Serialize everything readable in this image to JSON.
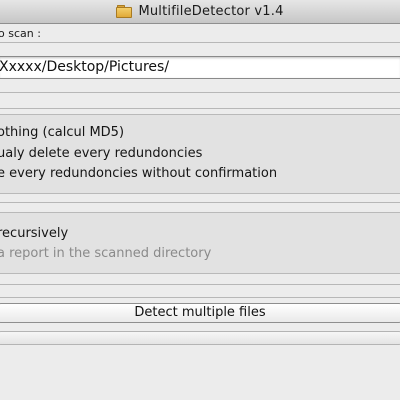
{
  "window": {
    "title": "MultifileDetector v1.4",
    "icon": "folder-icon"
  },
  "scan": {
    "label": "o scan :",
    "path_value": "Xxxxx/Desktop/Pictures/"
  },
  "action_options": {
    "items": [
      {
        "label": "othing (calcul MD5)",
        "enabled": true
      },
      {
        "label": "ualy delete every redundoncies",
        "enabled": true
      },
      {
        "label": "e every redundoncies without confirmation",
        "enabled": true
      }
    ]
  },
  "scan_options": {
    "items": [
      {
        "label": "recursively",
        "enabled": true
      },
      {
        "label": "a report in the scanned directory",
        "enabled": false
      }
    ]
  },
  "buttons": {
    "detect_label": "Detect multiple files"
  }
}
